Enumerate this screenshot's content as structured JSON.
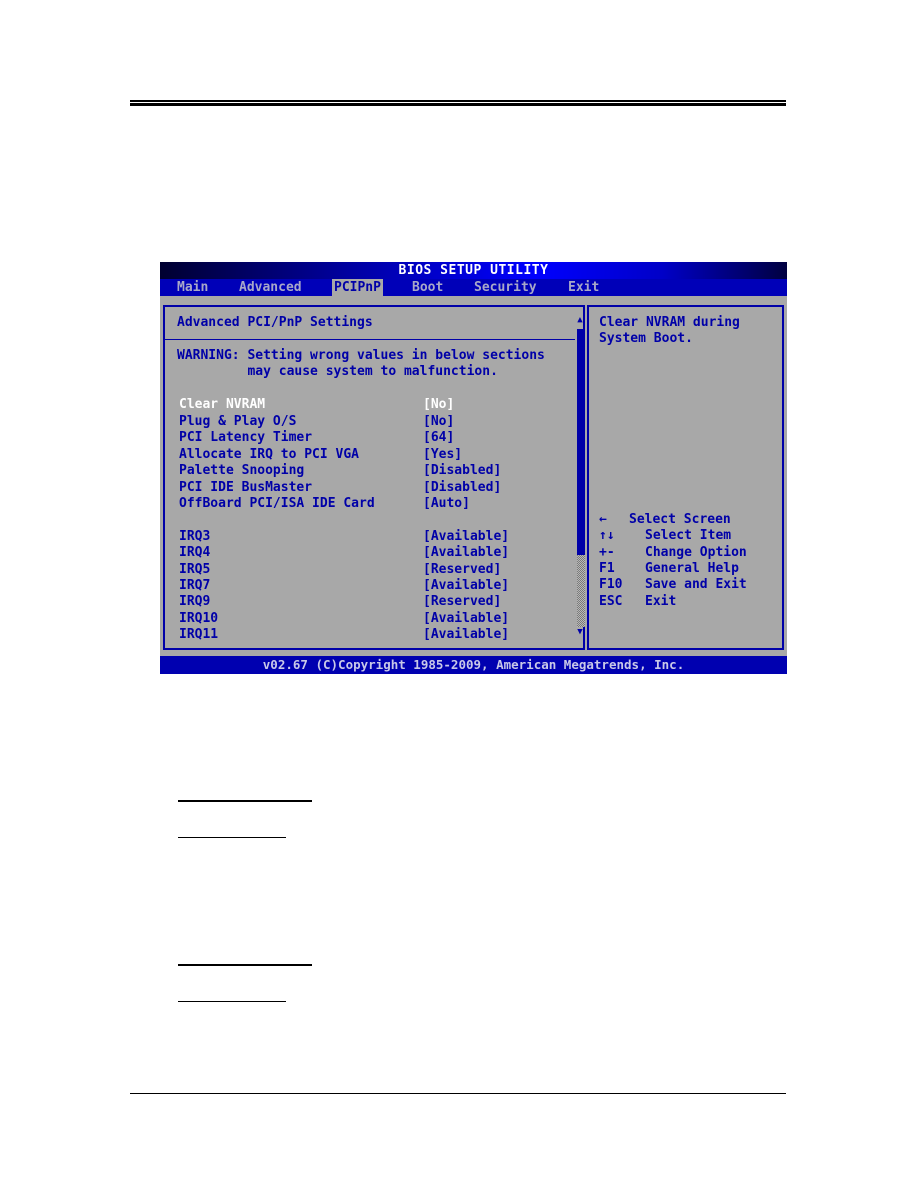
{
  "bios": {
    "title": "BIOS SETUP UTILITY",
    "tabs": [
      {
        "label": "Main",
        "active": false
      },
      {
        "label": "Advanced",
        "active": false
      },
      {
        "label": "PCIPnP",
        "active": true
      },
      {
        "label": "Boot",
        "active": false
      },
      {
        "label": "Security",
        "active": false
      },
      {
        "label": "Exit",
        "active": false
      }
    ],
    "panel": {
      "heading": "Advanced PCI/PnP Settings",
      "warning_line1": "WARNING: Setting wrong values in below sections",
      "warning_line2": "         may cause system to malfunction.",
      "items": [
        {
          "label": "Clear NVRAM",
          "value": "[No]",
          "selected": true
        },
        {
          "label": "Plug & Play O/S",
          "value": "[No]",
          "selected": false
        },
        {
          "label": "PCI Latency Timer",
          "value": "[64]",
          "selected": false
        },
        {
          "label": "Allocate IRQ to PCI VGA",
          "value": "[Yes]",
          "selected": false
        },
        {
          "label": "Palette Snooping",
          "value": "[Disabled]",
          "selected": false
        },
        {
          "label": "PCI IDE BusMaster",
          "value": "[Disabled]",
          "selected": false
        },
        {
          "label": "OffBoard PCI/ISA IDE Card",
          "value": "[Auto]",
          "selected": false
        }
      ],
      "irq_items": [
        {
          "label": "IRQ3",
          "value": "[Available]"
        },
        {
          "label": "IRQ4",
          "value": "[Available]"
        },
        {
          "label": "IRQ5",
          "value": "[Reserved]"
        },
        {
          "label": "IRQ7",
          "value": "[Available]"
        },
        {
          "label": "IRQ9",
          "value": "[Reserved]"
        },
        {
          "label": "IRQ10",
          "value": "[Available]"
        },
        {
          "label": "IRQ11",
          "value": "[Available]"
        }
      ],
      "scroll_up_glyph": "▲",
      "scroll_down_glyph": "▼",
      "scroll_thumb_fraction": 0.76
    },
    "help": {
      "line1": "Clear NVRAM during",
      "line2": "System Boot."
    },
    "keys": [
      {
        "key": "←",
        "desc": "Select Screen",
        "icon": "left-arrow-icon"
      },
      {
        "key": "↑↓",
        "desc": "Select Item",
        "icon": "up-down-arrows-icon"
      },
      {
        "key": "+-",
        "desc": "Change Option",
        "icon": ""
      },
      {
        "key": "F1",
        "desc": "General Help",
        "icon": ""
      },
      {
        "key": "F10",
        "desc": "Save and Exit",
        "icon": ""
      },
      {
        "key": "ESC",
        "desc": "Exit",
        "icon": ""
      }
    ],
    "status": "v02.67 (C)Copyright 1985-2009, American Megatrends, Inc."
  },
  "colors": {
    "bios_background": "#a8a8a8",
    "bios_text": "#0000a8",
    "bios_selected_text": "#ffffff",
    "bios_bar": "#0000b8"
  }
}
